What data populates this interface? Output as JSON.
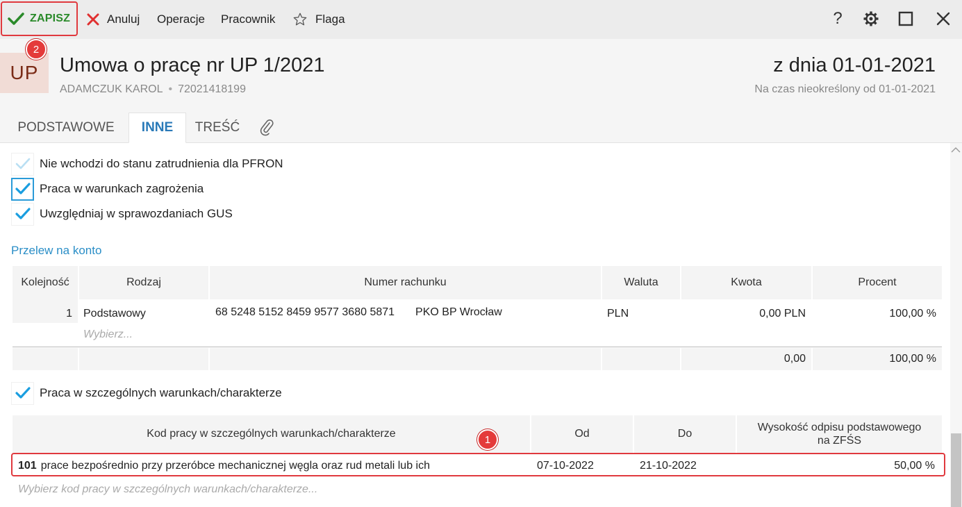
{
  "toolbar": {
    "save_label": "ZAPISZ",
    "cancel_label": "Anuluj",
    "operations_label": "Operacje",
    "employee_label": "Pracownik",
    "flag_label": "Flaga",
    "help_label": "?"
  },
  "badges": {
    "save_badge": "2",
    "row_badge": "1"
  },
  "header": {
    "doc_type": "UP",
    "title": "Umowa o pracę nr UP 1/2021",
    "employee_name": "ADAMCZUK KAROL",
    "employee_id": "72021418199",
    "date": "z dnia 01-01-2021",
    "period": "Na czas nieokreślony od 01-01-2021"
  },
  "tabs": [
    {
      "label": "PODSTAWOWE",
      "active": false
    },
    {
      "label": "INNE",
      "active": true
    },
    {
      "label": "TREŚĆ",
      "active": false
    }
  ],
  "checkboxes": [
    {
      "label": "Nie wchodzi do stanu zatrudnienia dla PFRON",
      "state": "indeterminate"
    },
    {
      "label": "Praca w warunkach zagrożenia",
      "state": "checked"
    },
    {
      "label": "Uwzględniaj w sprawozdaniach GUS",
      "state": "checked"
    }
  ],
  "transfer": {
    "section_title": "Przelew na konto",
    "headers": [
      "Kolejność",
      "Rodzaj",
      "Numer rachunku",
      "Waluta",
      "Kwota",
      "Procent"
    ],
    "rows": [
      {
        "order": "1",
        "type": "Podstawowy",
        "account": "68 5248 5152 8459 9577 3680 5871",
        "bank": "PKO BP Wrocław",
        "currency": "PLN",
        "amount": "0,00 PLN",
        "percent": "100,00 %"
      }
    ],
    "new_row_placeholder": "Wybierz...",
    "totals": {
      "amount": "0,00",
      "percent": "100,00 %"
    }
  },
  "special": {
    "checkbox_label": "Praca w szczególnych warunkach/charakterze",
    "checkbox_state": "checked",
    "headers": [
      "Kod pracy w szczególnych warunkach/charakterze",
      "Od",
      "Do",
      "Wysokość odpisu podstawowego na ZFŚS"
    ],
    "header_zfss_line1": "Wysokość odpisu podstawowego",
    "header_zfss_line2": "na ZFŚS",
    "row": {
      "code": "101",
      "description": "prace bezpośrednio przy przeróbce mechanicznej węgla oraz rud metali lub ich",
      "from": "07-10-2022",
      "to": "21-10-2022",
      "rate": "50,00 %"
    },
    "new_row_placeholder": "Wybierz kod pracy w szczególnych warunkach/charakterze..."
  },
  "colors": {
    "accent": "#2a7ab8",
    "save_green": "#2a8a2a",
    "highlight_red": "#e0393e",
    "cancel_red": "#e03030"
  }
}
